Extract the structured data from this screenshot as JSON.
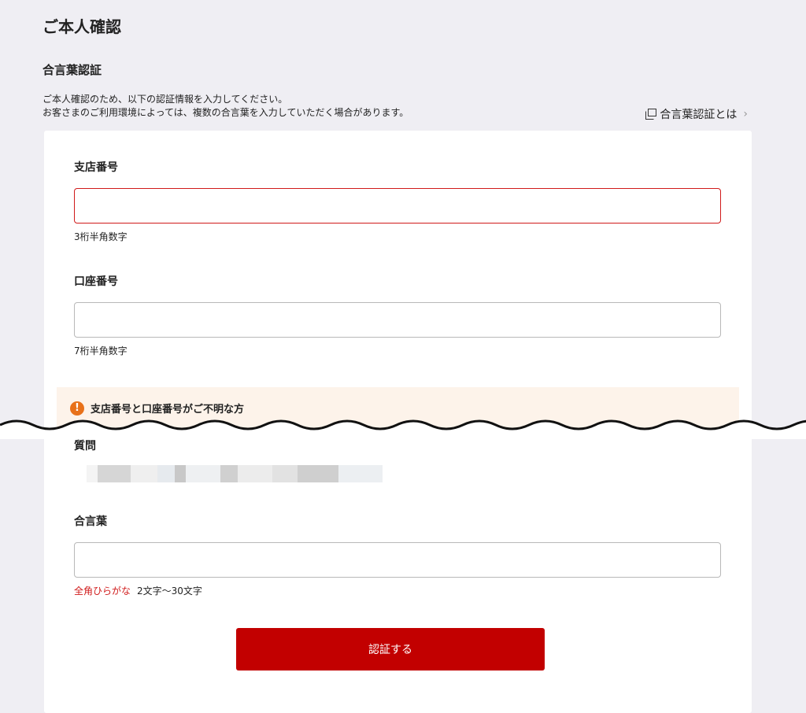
{
  "page": {
    "title": "ご本人確認",
    "section_title": "合言葉認証",
    "desc_line1": "ご本人確認のため、以下の認証情報を入力してください。",
    "desc_line2": "お客さまのご利用環境によっては、複数の合言葉を入力していただく場合があります。",
    "help_link": "合言葉認証とは",
    "help_icon": "external-window-icon",
    "chevron_icon": "chevron-right-icon"
  },
  "form": {
    "branch": {
      "label": "支店番号",
      "value": "",
      "hint": "3桁半角数字"
    },
    "account": {
      "label": "口座番号",
      "value": "",
      "hint": "7桁半角数字"
    },
    "notice": {
      "icon": "warning-icon",
      "text": "支店番号と口座番号がご不明な方"
    },
    "question": {
      "label": "質問"
    },
    "passphrase": {
      "label": "合言葉",
      "value": "",
      "hint_red": "全角ひらがな",
      "hint": "2文字～30文字"
    },
    "submit_label": "認証する"
  },
  "colors": {
    "accent": "#c20000",
    "error_border": "#d01a1a",
    "notice_bg": "#fdf3ea",
    "warning": "#e8711a",
    "page_bg": "#efeef3"
  }
}
